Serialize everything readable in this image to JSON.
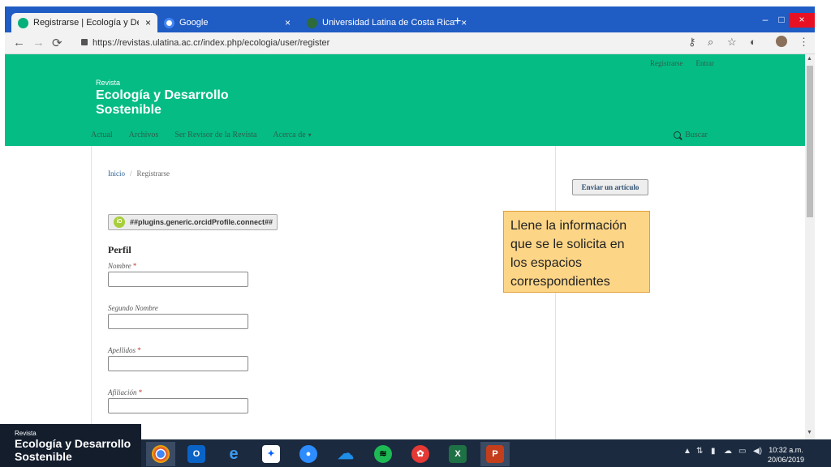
{
  "browser": {
    "tabs": [
      {
        "label": "Registrarse | Ecología y Desarrollo",
        "close": "×",
        "color": "#07b07a"
      },
      {
        "label": "Google",
        "close": "×",
        "color": "#4285f4"
      },
      {
        "label": "Universidad Latina de Costa Rica",
        "close": "×",
        "color": "#2e6b3a"
      }
    ],
    "new_tab": "+",
    "window_buttons": {
      "minimize": "–",
      "maximize": "□",
      "close": "×"
    },
    "url": "https://revistas.ulatina.ac.cr/index.php/ecologia/user/register",
    "nav": {
      "back": "←",
      "forward": "→",
      "reload": "⟳"
    },
    "icons": [
      "key-icon",
      "zoom-icon",
      "star-icon",
      "extension-icon",
      "profile-icon",
      "menu-icon"
    ]
  },
  "site": {
    "top_links": [
      "Registrarse",
      "Entrar"
    ],
    "brand_small": "Revista",
    "brand_title": "Ecología y Desarrollo Sostenible",
    "nav_items": [
      "Actual",
      "Archivos",
      "Ser Revisor de la Revista",
      "Acerca de"
    ],
    "nav_caret": "▾",
    "search_label": "Buscar",
    "header_color": "#05bc84"
  },
  "breadcrumb": {
    "home": "Inicio",
    "separator": "/",
    "current": "Registrarse"
  },
  "orcid_button": {
    "icon": "iD",
    "label": "##plugins.generic.orcidProfile.connect##"
  },
  "form": {
    "section_title": "Perfil",
    "fields": [
      {
        "label": "Nombre",
        "required": "*",
        "value": ""
      },
      {
        "label": "Segundo Nombre",
        "required": "",
        "value": ""
      },
      {
        "label": "Apellidos",
        "required": "*",
        "value": ""
      },
      {
        "label": "Afiliación",
        "required": "*",
        "value": ""
      }
    ]
  },
  "sidebar": {
    "submit_button": "Enviar un artículo"
  },
  "callout": {
    "text": "Llene la información que se le solicita en los espacios correspondientes"
  },
  "overlay_logo": {
    "small": "Revista",
    "title": "Ecología y Desarrollo Sostenible"
  },
  "taskbar": {
    "apps": [
      {
        "name": "chrome-icon",
        "glyph": "",
        "color": "#db4437"
      },
      {
        "name": "outlook-icon",
        "glyph": "O",
        "color": "#0a64c8"
      },
      {
        "name": "edge-icon",
        "glyph": "e",
        "color": "#1e88e5"
      },
      {
        "name": "dropbox-icon",
        "glyph": "✦",
        "color": "#0061fe"
      },
      {
        "name": "zoom-icon",
        "glyph": "●",
        "color": "#2d8cff"
      },
      {
        "name": "onedrive-icon",
        "glyph": "☁",
        "color": "#0a78d4"
      },
      {
        "name": "spotify-icon",
        "glyph": "≋",
        "color": "#1db954"
      },
      {
        "name": "huawei-icon",
        "glyph": "✿",
        "color": "#e53935"
      },
      {
        "name": "excel-icon",
        "glyph": "X",
        "color": "#1e7145"
      },
      {
        "name": "powerpoint-icon",
        "glyph": "P",
        "color": "#c43e1c"
      }
    ],
    "clock": {
      "time": "10:32 a.m.",
      "date": "20/06/2019"
    }
  }
}
